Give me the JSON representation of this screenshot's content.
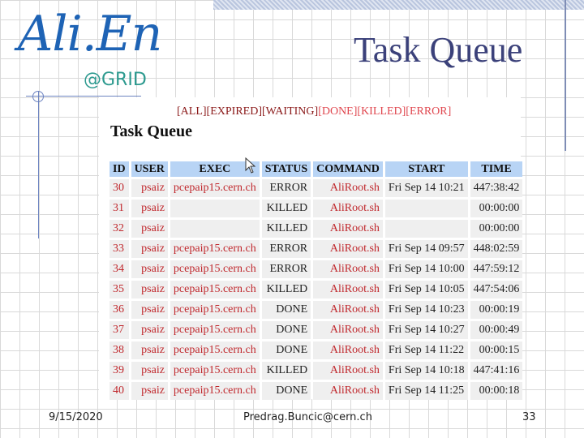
{
  "logo": {
    "main": "Ali.En",
    "sub": "@GRID"
  },
  "slide_title": "Task Queue",
  "panel": {
    "filters": [
      {
        "label": "[ALL]",
        "color": "#8b1a1a"
      },
      {
        "label": "[EXPIRED]",
        "color": "#8b1a1a"
      },
      {
        "label": "[WAITING]",
        "color": "#8b1a1a"
      },
      {
        "label": "[DONE]",
        "color": "#e0474f"
      },
      {
        "label": "[KILLED]",
        "color": "#e0474f"
      },
      {
        "label": "[ERROR]",
        "color": "#e0474f"
      }
    ],
    "heading": "Task Queue",
    "table": {
      "columns": [
        "ID",
        "USER",
        "EXEC",
        "STATUS",
        "COMMAND",
        "START",
        "TIME"
      ],
      "rows": [
        [
          "30",
          "psaiz",
          "pcepaip15.cern.ch",
          "ERROR",
          "AliRoot.sh",
          "Fri Sep 14 10:21",
          "447:38:42"
        ],
        [
          "31",
          "psaiz",
          "",
          "KILLED",
          "AliRoot.sh",
          "",
          "00:00:00"
        ],
        [
          "32",
          "psaiz",
          "",
          "KILLED",
          "AliRoot.sh",
          "",
          "00:00:00"
        ],
        [
          "33",
          "psaiz",
          "pcepaip15.cern.ch",
          "ERROR",
          "AliRoot.sh",
          "Fri Sep 14 09:57",
          "448:02:59"
        ],
        [
          "34",
          "psaiz",
          "pcepaip15.cern.ch",
          "ERROR",
          "AliRoot.sh",
          "Fri Sep 14 10:00",
          "447:59:12"
        ],
        [
          "35",
          "psaiz",
          "pcepaip15.cern.ch",
          "KILLED",
          "AliRoot.sh",
          "Fri Sep 14 10:05",
          "447:54:06"
        ],
        [
          "36",
          "psaiz",
          "pcepaip15.cern.ch",
          "DONE",
          "AliRoot.sh",
          "Fri Sep 14 10:23",
          "00:00:19"
        ],
        [
          "37",
          "psaiz",
          "pcepaip15.cern.ch",
          "DONE",
          "AliRoot.sh",
          "Fri Sep 14 10:27",
          "00:00:49"
        ],
        [
          "38",
          "psaiz",
          "pcepaip15.cern.ch",
          "DONE",
          "AliRoot.sh",
          "Fri Sep 14 11:22",
          "00:00:15"
        ],
        [
          "39",
          "psaiz",
          "pcepaip15.cern.ch",
          "KILLED",
          "AliRoot.sh",
          "Fri Sep 14 10:18",
          "447:41:16"
        ],
        [
          "40",
          "psaiz",
          "pcepaip15.cern.ch",
          "DONE",
          "AliRoot.sh",
          "Fri Sep 14 11:25",
          "00:00:18"
        ]
      ]
    }
  },
  "footer": {
    "date": "9/15/2020",
    "email": "Predrag.Buncic@cern.ch",
    "page": "33"
  }
}
